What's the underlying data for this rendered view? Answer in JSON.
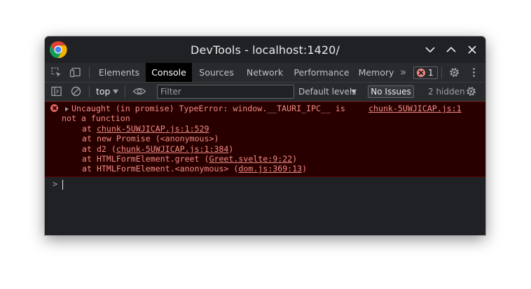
{
  "window": {
    "title": "DevTools - localhost:1420/"
  },
  "tabs": [
    {
      "label": "Elements",
      "active": false
    },
    {
      "label": "Console",
      "active": true
    },
    {
      "label": "Sources",
      "active": false
    },
    {
      "label": "Network",
      "active": false
    },
    {
      "label": "Performance",
      "active": false
    },
    {
      "label": "Memory",
      "active": false
    }
  ],
  "tabbar": {
    "error_count": "1"
  },
  "filterbar": {
    "context": "top",
    "filter_placeholder": "Filter",
    "levels": "Default levels",
    "issues_button": "No Issues",
    "hidden": "2 hidden"
  },
  "console": {
    "error": {
      "line1": "Uncaught (in promise) TypeError: window.__TAURI_IPC__ is",
      "line2": "not a function",
      "source": "chunk-5UWJICAP.js:1",
      "stack": [
        {
          "prefix": "at ",
          "func": "",
          "link": "chunk-5UWJICAP.js:1:529",
          "suffix": ""
        },
        {
          "prefix": "at new Promise (<anonymous>)",
          "func": "",
          "link": "",
          "suffix": ""
        },
        {
          "prefix": "at d2 (",
          "func": "",
          "link": "chunk-5UWJICAP.js:1:384",
          "suffix": ")"
        },
        {
          "prefix": "at HTMLFormElement.greet (",
          "func": "",
          "link": "Greet.svelte:9:22",
          "suffix": ")"
        },
        {
          "prefix": "at HTMLFormElement.<anonymous> (",
          "func": "",
          "link": "dom.js:369:13",
          "suffix": ")"
        }
      ]
    },
    "prompt": ">"
  },
  "colors": {
    "panel_bg": "#202124",
    "toolbar_bg": "#292a2d",
    "error_bg": "#290000",
    "error_text": "#f28b82",
    "accent_active_tab": "#000000"
  },
  "icons": [
    "chrome-logo-icon",
    "chevron-down-icon",
    "chevron-up-icon",
    "close-icon",
    "inspect-element-icon",
    "device-toolbar-icon",
    "more-tabs-icon",
    "error-icon",
    "settings-gear-icon",
    "kebab-menu-icon",
    "sidebar-toggle-icon",
    "clear-console-icon",
    "eye-icon"
  ]
}
